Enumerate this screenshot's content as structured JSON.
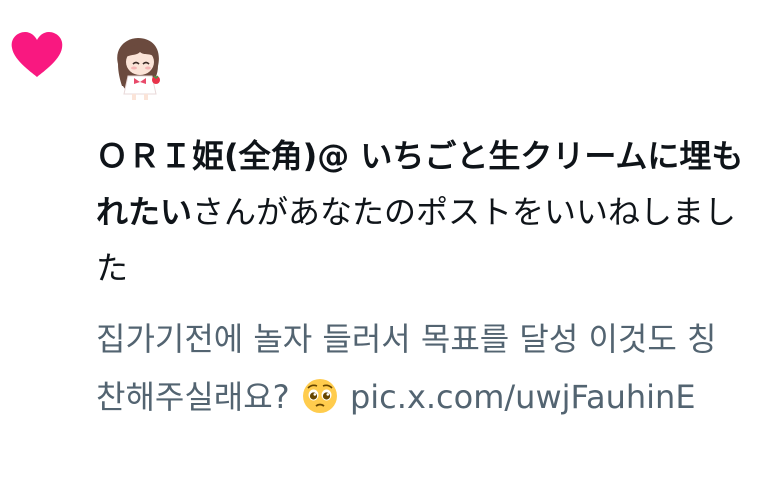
{
  "notification": {
    "type": "like",
    "heart_icon": "heart-icon",
    "heart_color": "#f91880",
    "avatar_icon": "chibi-anime-girl-avatar",
    "user_display_name": "ＯＲＩ姫(全角)@ いちごと生クリームに埋もれたい",
    "action_text": "さんがあなたのポストをいいねしました",
    "post_preview": {
      "text_before_emoji": "집가기전에 놀자 들러서 목표를 달성 이것도 칭찬해주실래요? ",
      "emoji": "pleading-face-emoji",
      "link_text": " pic.x.com/uwjFauhinE"
    },
    "text_color": "#0f1419",
    "muted_text_color": "#536471"
  }
}
